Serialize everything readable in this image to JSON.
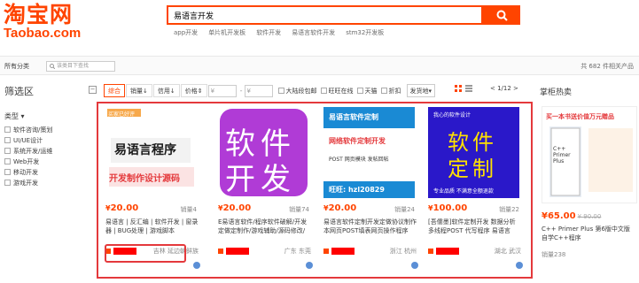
{
  "header": {
    "logo_cn": "淘宝网",
    "logo_en": "Taobao.com",
    "search_value": "易语言开发",
    "hot_words": [
      "app开发",
      "单片机开发板",
      "软件开发",
      "易语言软件开发",
      "stm32开发板"
    ]
  },
  "category_bar": {
    "all_categories": "所有分类",
    "search_placeholder": "该类目下查找",
    "result_count": "共 682 件相关产品"
  },
  "filter": {
    "title": "筛选区",
    "collapse": "−",
    "type_title": "类型 ▾",
    "types": [
      "软件咨询/策划",
      "UI/UE设计",
      "系统开发/运维",
      "Web开发",
      "移动开发",
      "游戏开发"
    ]
  },
  "toolbar": {
    "sorts": [
      "综合",
      "销量",
      "信用",
      "价格"
    ],
    "price_from": "¥",
    "price_to": "¥",
    "dash": "-",
    "checks": [
      "大陆段包邮",
      "旺旺在线",
      "天猫",
      "折扣"
    ],
    "ship_from": "发货地",
    "pager": "< 1/12 >"
  },
  "products": [
    {
      "badge": "买家已好评",
      "img_line1": "易语言程序",
      "img_line2": "开发制作设计源码",
      "price": "20.00",
      "sold": "销量4",
      "title": "易语言 | 反汇编 | 软件开发 | 窗录器 | BUG处理 | 游戏脚本",
      "location": "吉林 延边朝鲜族"
    },
    {
      "img_line1": "软件",
      "img_line2": "开发",
      "price": "20.00",
      "sold": "销量74",
      "title": "E易语言软件/程序软件破解/开发定做定制作/游戏辅助/源码修改/",
      "location": "广东 东莞"
    },
    {
      "img_line1": "易语言软件定制",
      "img_line2": "网络软件定制开发",
      "img_line3": "POST 网页模块 发帖回帖",
      "img_line4": "旺旺: hzl20829",
      "price": "20.00",
      "sold": "销量24",
      "title": "易语言软件定制开发定做协议制作本网页POST填表网页操作程序",
      "location": "浙江 杭州"
    },
    {
      "img_line1": "软件",
      "img_line2": "定制",
      "img_top": "我心的软件设计",
      "img_bottom": "专业品质 不满意全额退款",
      "price": "100.00",
      "sold": "销量22",
      "title": "[吾儒墨]软件定制开发 数据分析 多线程POST 代写程序 易语言",
      "location": "湖北 武汉"
    }
  ],
  "hot": {
    "title": "掌柜热卖",
    "banner": "买一本书送价值万元赠品",
    "book_title": "C++ Primer Plus",
    "price": "65.00",
    "orig": "¥ 90.00",
    "label": "C++ Primer Plus 第6版中文版 \n 自学C++程序",
    "sold": "销量238"
  },
  "colors": {
    "accent": "#ff4400",
    "highlight": "#e4393c",
    "card2_bg": "#b03bd6",
    "card4_bg": "#2a18c9"
  }
}
